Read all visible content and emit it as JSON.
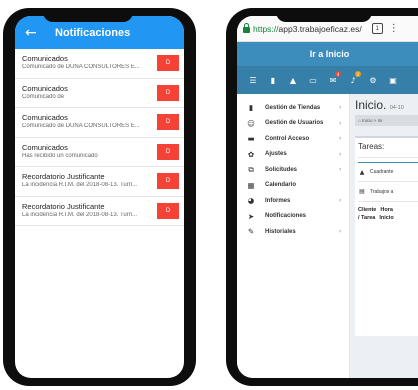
{
  "phone1": {
    "back_icon": "arrow-left-icon",
    "title": "Notificaciones",
    "notifications": [
      {
        "title": "Comunicados",
        "subtitle": "Comunicado de DUNA CONSULTORES E...",
        "button": "D"
      },
      {
        "title": "Comunicados",
        "subtitle": "Comunicado de",
        "button": "D"
      },
      {
        "title": "Comunicados",
        "subtitle": "Comunicado de DUNA CONSULTORES E...",
        "button": "D"
      },
      {
        "title": "Comunicados",
        "subtitle": "Has recibido un comunicado",
        "button": "D"
      },
      {
        "title": "Recordatorio Justificante",
        "subtitle": "La incidencia R.I.M. del 2018-08-13. Turn...",
        "button": "D"
      },
      {
        "title": "Recordatorio Justificante",
        "subtitle": "La incidencia R.I.M. del 2018-08-13. Turn...",
        "button": "D"
      }
    ]
  },
  "phone2": {
    "url": {
      "scheme": "https://",
      "host": "app3.trabajoeficaz.es/"
    },
    "tabs_count": "1",
    "header": "Ir a Inicio",
    "toolbar": {
      "badge_notifications": "4",
      "badge_alerts": "2"
    },
    "sidebar": [
      {
        "icon": "store-icon",
        "glyph": "▮",
        "label": "Gestión de Tiendas",
        "chevron": "‹"
      },
      {
        "icon": "users-icon",
        "glyph": "☺",
        "label": "Gestión de Usuarios",
        "chevron": "‹"
      },
      {
        "icon": "card-icon",
        "glyph": "▬",
        "label": "Control Acceso",
        "chevron": "‹"
      },
      {
        "icon": "gear-icon",
        "glyph": "✿",
        "label": "Ajustes",
        "chevron": "‹"
      },
      {
        "icon": "requests-icon",
        "glyph": "⧉",
        "label": "Solicitudes",
        "chevron": "‹"
      },
      {
        "icon": "calendar-icon",
        "glyph": "▦",
        "label": "Calendario",
        "chevron": ""
      },
      {
        "icon": "pie-chart-icon",
        "glyph": "◕",
        "label": "Informes",
        "chevron": "‹"
      },
      {
        "icon": "paper-plane-icon",
        "glyph": "➤",
        "label": "Notificaciones",
        "chevron": ""
      },
      {
        "icon": "edit-icon",
        "glyph": "✎",
        "label": "Historiales",
        "chevron": "‹"
      }
    ],
    "main": {
      "title": "Inicio.",
      "date": "04-10",
      "breadcrumb_home": "⌂ Inicio",
      "breadcrumb_sep": ">",
      "breadcrumb_current": "Ini",
      "card_title": "Tareas:",
      "tabs": [
        {
          "glyph": "▲",
          "label": "Cuadrante"
        },
        {
          "glyph": "▤",
          "label": "Trabajos a"
        }
      ],
      "table_headers": [
        "Cliente",
        "Hora",
        "/ Tarea",
        "Inicio"
      ]
    }
  }
}
